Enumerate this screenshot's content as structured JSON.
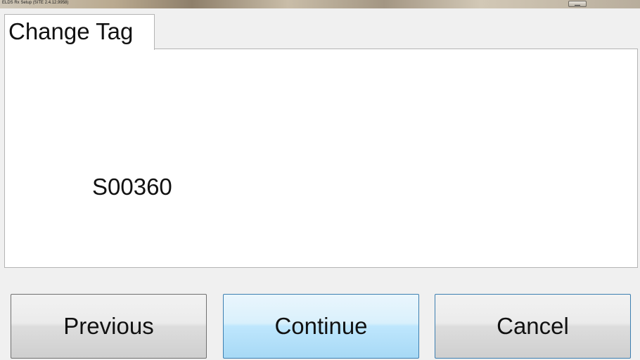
{
  "window": {
    "title": "ELDS Rx Setup (SITE 2.4.12.9958)"
  },
  "tab": {
    "label": "Change Tag"
  },
  "panel": {
    "tag_value": "S00360"
  },
  "buttons": {
    "previous": "Previous",
    "continue": "Continue",
    "cancel": "Cancel"
  },
  "colors": {
    "continue_bg": "#bee6fd",
    "focus_border": "#3c7fb1",
    "panel_bg": "#ffffff",
    "window_bg": "#f0f0f0"
  }
}
